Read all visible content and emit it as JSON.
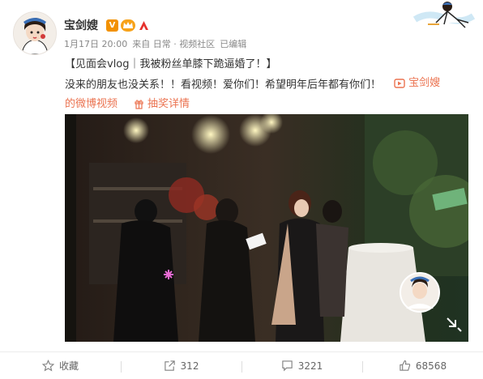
{
  "post": {
    "author": "宝剑嫂",
    "date": "1月17日 20:00",
    "source": "来自 日常 · 视频社区",
    "edited": "已编辑",
    "title_line": "【见面会vlog｜我被粉丝单膝下跪逼婚了！】",
    "body_line": "没来的朋友也没关系！！看视频！爱你们！希望明年后年都有你们！",
    "video_link_a": "宝剑嫂",
    "video_link_b": "的微博视频",
    "lottery_link": "抽奖详情"
  },
  "actions": {
    "favorite": "收藏",
    "repost": "312",
    "comment": "3221",
    "like": "68568"
  },
  "colors": {
    "accent": "#eb7350",
    "vbadge": "#f29100"
  },
  "icons": [
    "verified-icon",
    "vip-icon",
    "flame-icon",
    "video-link-icon",
    "gift-icon",
    "star-icon",
    "repost-icon",
    "comment-icon",
    "like-icon"
  ]
}
